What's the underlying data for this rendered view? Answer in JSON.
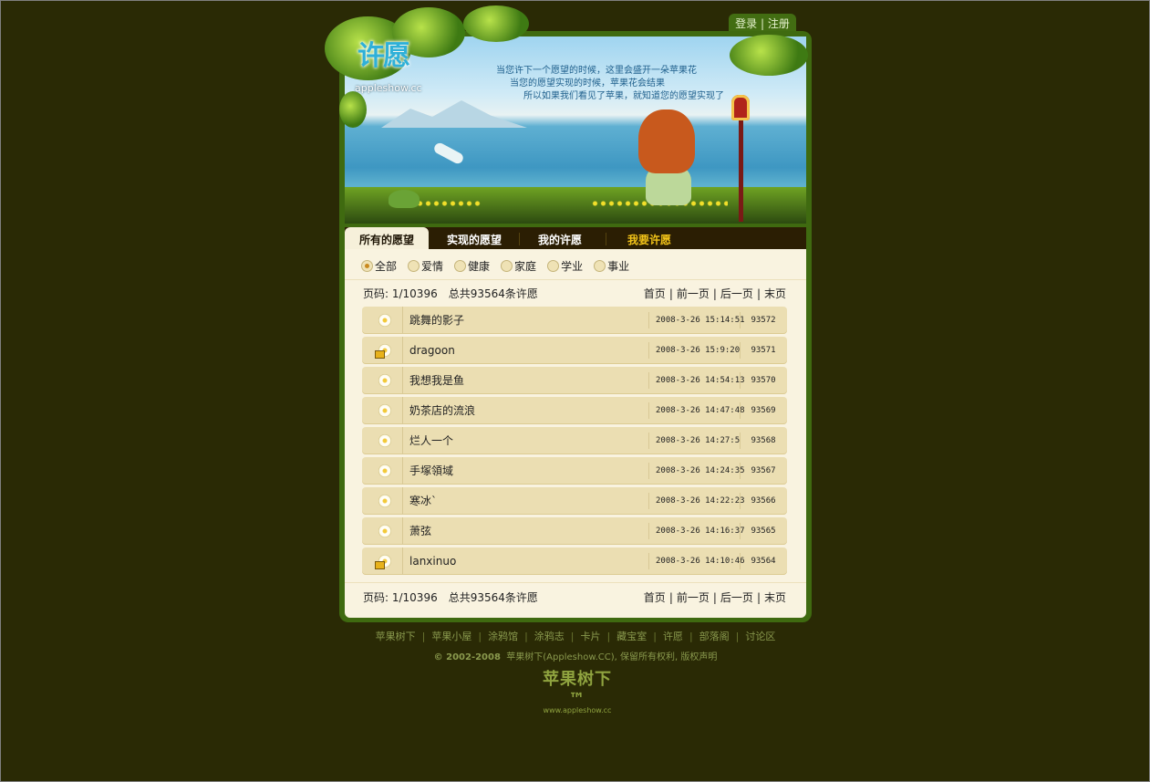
{
  "auth": {
    "login": "登录",
    "sep": "|",
    "register": "注册"
  },
  "logo": {
    "title": "许愿",
    "url": "appleshow.cc"
  },
  "hero": {
    "line1": "当您许下一个愿望的时候，这里会盛开一朵苹果花",
    "line2": "当您的愿望实现的时候，苹果花会结果",
    "line3": "所以如果我们看见了苹果，就知道您的愿望实现了"
  },
  "tabs": [
    "所有的愿望",
    "实现的愿望",
    "我的许愿",
    "我要许愿"
  ],
  "filters": [
    "全部",
    "爱情",
    "健康",
    "家庭",
    "学业",
    "事业"
  ],
  "pager": {
    "page_label": "页码: 1/10396",
    "total_label": "总共93564条许愿",
    "first": "首页",
    "prev": "前一页",
    "next": "后一页",
    "last": "末页",
    "sep": "|"
  },
  "wishes": [
    {
      "name": "跳舞的影子",
      "date": "2008-3-26 15:14:51",
      "id": "93572",
      "locked": false
    },
    {
      "name": "dragoon",
      "date": "2008-3-26 15:9:20",
      "id": "93571",
      "locked": true
    },
    {
      "name": "我想我是鱼",
      "date": "2008-3-26 14:54:13",
      "id": "93570",
      "locked": false
    },
    {
      "name": "奶茶店的流浪",
      "date": "2008-3-26 14:47:48",
      "id": "93569",
      "locked": false
    },
    {
      "name": "烂人一个",
      "date": "2008-3-26 14:27:5",
      "id": "93568",
      "locked": false
    },
    {
      "name": "手塚領域",
      "date": "2008-3-26 14:24:35",
      "id": "93567",
      "locked": false
    },
    {
      "name": "寒冰`",
      "date": "2008-3-26 14:22:23",
      "id": "93566",
      "locked": false
    },
    {
      "name": "萧弦",
      "date": "2008-3-26 14:16:37",
      "id": "93565",
      "locked": false
    },
    {
      "name": "lanxinuo",
      "date": "2008-3-26 14:10:46",
      "id": "93564",
      "locked": true
    }
  ],
  "footer": {
    "links": [
      "苹果树下",
      "苹果小屋",
      "涂鸦馆",
      "涂鸦志",
      "卡片",
      "藏宝室",
      "许愿",
      "部落阁",
      "讨论区"
    ],
    "copyright_prefix": "© 2002-2008",
    "copyright_site": "苹果树下(Appleshow.CC),",
    "copyright_suffix": "保留所有权利, 版权声明",
    "logo_text": "苹果树下™",
    "logo_url": "www.appleshow.cc"
  },
  "colors": {
    "background": "#2a2a05",
    "frame_green": "#3f6a10",
    "content_bg": "#f9f3e0",
    "row_bg": "#ebdeb2",
    "tab_highlight": "#f2c319"
  }
}
